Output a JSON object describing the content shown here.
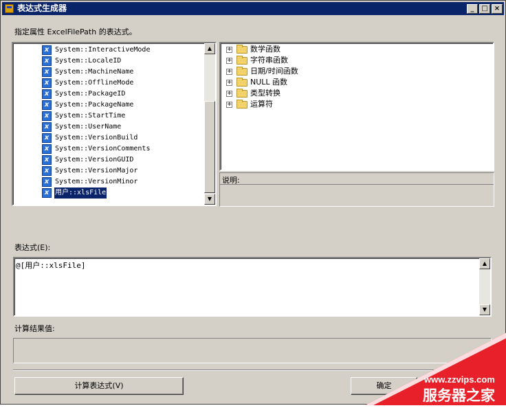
{
  "window": {
    "title": "表达式生成器",
    "controls": {
      "minimize": "_",
      "maximize": "□",
      "close": "×"
    }
  },
  "instruction": "指定属性 ExcelFilePath 的表达式。",
  "variables": {
    "icon": "variable-icon",
    "items": [
      "System::InteractiveMode",
      "System::LocaleID",
      "System::MachineName",
      "System::OfflineMode",
      "System::PackageID",
      "System::PackageName",
      "System::StartTime",
      "System::UserName",
      "System::VersionBuild",
      "System::VersionComments",
      "System::VersionGUID",
      "System::VersionMajor",
      "System::VersionMinor",
      "用户::xlsFile"
    ],
    "selected_index": 13
  },
  "functions": {
    "icon": "folder-icon",
    "items": [
      "数学函数",
      "字符串函数",
      "日期/时间函数",
      "NULL 函数",
      "类型转换",
      "运算符"
    ]
  },
  "description_label": "说明:",
  "expression": {
    "label": "表达式(E):",
    "value": "@[用户::xlsFile]"
  },
  "result": {
    "label": "计算结果值:",
    "value": ""
  },
  "buttons": {
    "evaluate": "计算表达式(V)",
    "ok": "确定"
  },
  "watermark": {
    "url": "www.zzvips.com",
    "brand": "服务器之家",
    "color": "#e8202a"
  }
}
